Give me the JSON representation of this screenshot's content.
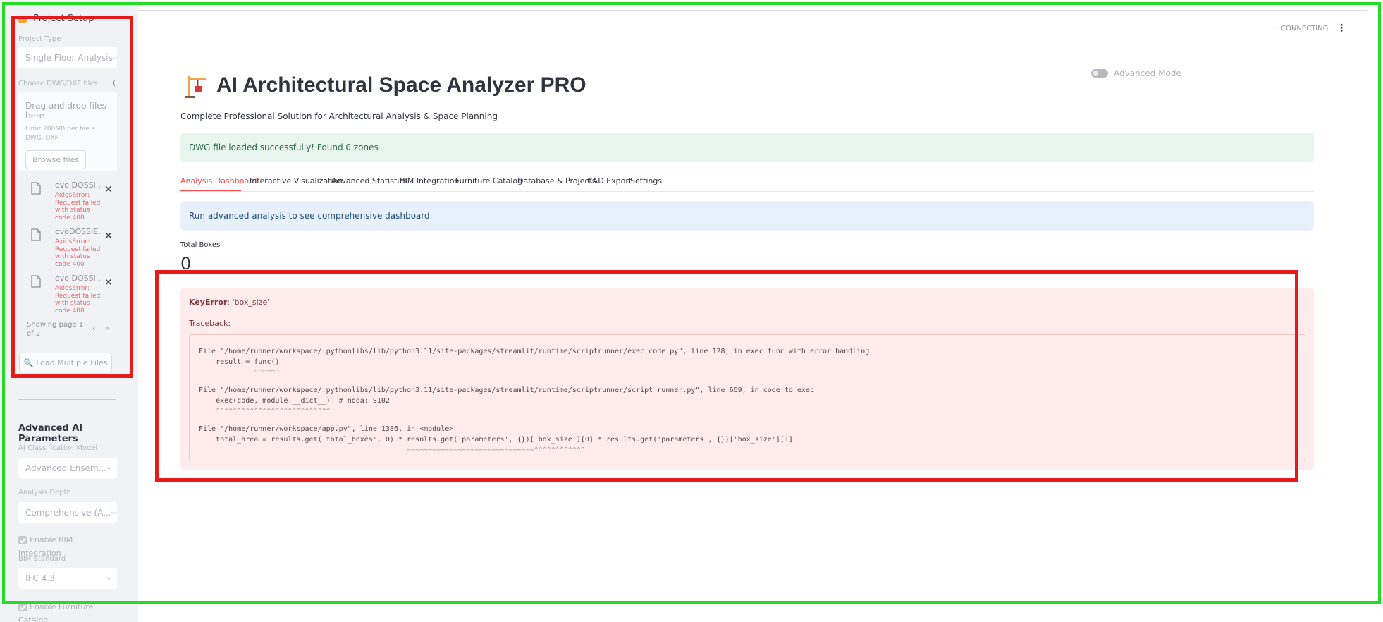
{
  "sidebar": {
    "section_title": "Project Setup",
    "project_type_label": "Project Type",
    "project_type_value": "Single Floor Analysis",
    "uploader_label": "Choose DWG/DXF files",
    "uploader_drop": "Drag and drop files here",
    "uploader_limit": "Limit 200MB per file • DWG, DXF",
    "browse_label": "Browse files",
    "files": [
      {
        "name": "ovo DOSSI...",
        "error": "AxiosError: Request failed with status code 400"
      },
      {
        "name": "ovoDOSSIE...",
        "error": "AxiosError: Request failed with status code 400"
      },
      {
        "name": "ovo DOSSI...",
        "error": "AxiosError: Request failed with status code 400"
      }
    ],
    "pager_text": "Showing page 1 of 2",
    "load_button": "Load Multiple Files",
    "advanced_heading": "Advanced AI Parameters",
    "model_label": "AI Classification Model",
    "model_value": "Advanced Ensem...",
    "depth_label": "Analysis Depth",
    "depth_value": "Comprehensive (A...",
    "bim_checkbox": "Enable BIM Integration",
    "bim_standard_label": "BIM Standard",
    "bim_standard_value": "IFC 4.3",
    "furniture_checkbox": "Enable Furniture Catalog"
  },
  "header": {
    "status": "CONNECTING",
    "advanced_mode": "Advanced Mode"
  },
  "main": {
    "title": "AI Architectural Space Analyzer PRO",
    "subtitle": "Complete Professional Solution for Architectural Analysis & Space Planning",
    "success_msg": "DWG file loaded successfully! Found 0 zones",
    "tabs": [
      {
        "label": "Analysis Dashboard"
      },
      {
        "label": "Interactive Visualization"
      },
      {
        "label": "Advanced Statistics"
      },
      {
        "label": "BIM Integration"
      },
      {
        "label": "Furniture Catalog"
      },
      {
        "label": "Database & Projects"
      },
      {
        "label": "CAD Export"
      },
      {
        "label": "Settings"
      }
    ],
    "info_msg": "Run advanced analysis to see comprehensive dashboard",
    "metric_label": "Total Boxes",
    "metric_value": "0",
    "error": {
      "type": "KeyError",
      "message": ": 'box_size'",
      "traceback_label": "Traceback:",
      "lines": [
        "File \"/home/runner/workspace/.pythonlibs/lib/python3.11/site-packages/streamlit/runtime/scriptrunner/exec_code.py\", line 128, in exec_func_with_error_handling",
        "    result = func()",
        "             ^^^^^^",
        "File \"/home/runner/workspace/.pythonlibs/lib/python3.11/site-packages/streamlit/runtime/scriptrunner/script_runner.py\", line 669, in code_to_exec",
        "    exec(code, module.__dict__)  # noqa: S102",
        "    ^^^^^^^^^^^^^^^^^^^^^^^^^^^",
        "File \"/home/runner/workspace/app.py\", line 1386, in <module>",
        "    total_area = results.get('total_boxes', 0) * results.get('parameters', {})['box_size'][0] * results.get('parameters', {})['box_size'][1]",
        "                                                 ~~~~~~~~~~~~~~~~~~~~~~~~~~~~~~^^^^^^^^^^^^"
      ]
    }
  },
  "colors": {
    "accent": "#ff4b4b",
    "sidebar_bg": "#f0f2f6",
    "annotation_green": "#22dd22",
    "annotation_red": "#e41b1b"
  }
}
